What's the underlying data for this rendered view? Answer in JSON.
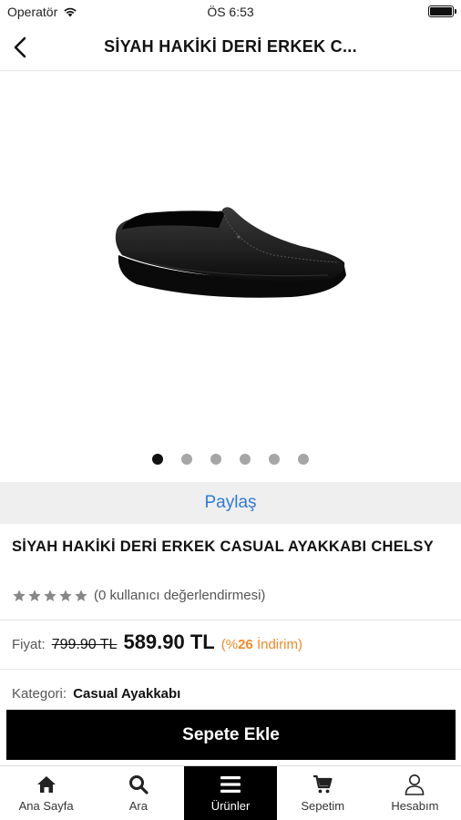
{
  "status_bar": {
    "carrier": "Operatör",
    "time": "ÖS 6:53"
  },
  "header": {
    "title": "SİYAH HAKİKİ DERİ ERKEK C..."
  },
  "gallery": {
    "image_count": 6,
    "active_index": 0
  },
  "share_label": "Paylaş",
  "product": {
    "title": "SİYAH HAKİKİ DERİ ERKEK CASUAL AYAKKABI CHELSY",
    "rating_stars": 0,
    "rating_text": "(0 kullanıcı değerlendirmesi)",
    "price_label": "Fiyat:",
    "old_price": "799.90 TL",
    "new_price": "589.90 TL",
    "discount_prefix": "(%",
    "discount_value": "26",
    "discount_suffix": "İndirim)",
    "category_label": "Kategori:",
    "category_value": "Casual Ayakkabı"
  },
  "add_to_cart_label": "Sepete Ekle",
  "tabs": [
    {
      "label": "Ana Sayfa",
      "icon": "home-icon"
    },
    {
      "label": "Ara",
      "icon": "search-icon"
    },
    {
      "label": "Ürünler",
      "icon": "menu-icon"
    },
    {
      "label": "Sepetim",
      "icon": "cart-icon"
    },
    {
      "label": "Hesabım",
      "icon": "user-icon"
    }
  ],
  "active_tab": 2,
  "colors": {
    "accent_link": "#2f7bd6",
    "discount": "#f08a2b",
    "primary_button": "#000000"
  }
}
